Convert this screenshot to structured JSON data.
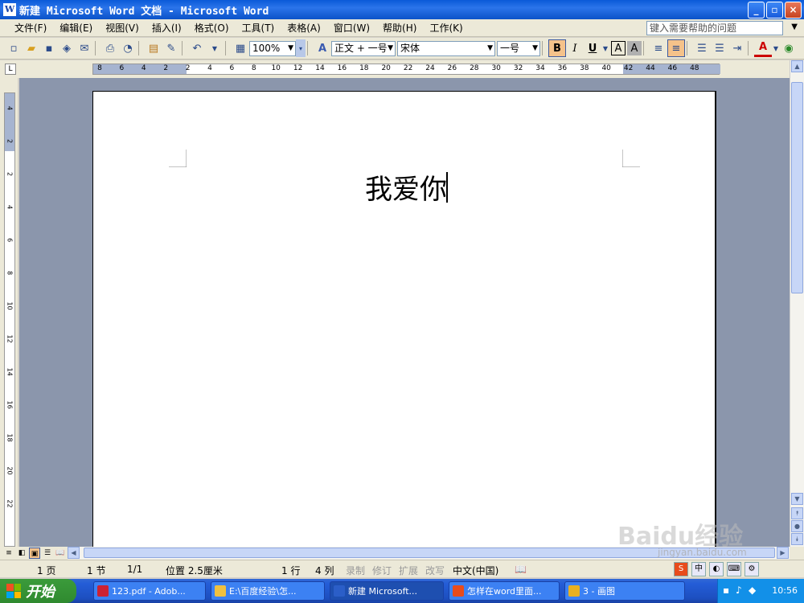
{
  "window": {
    "title": "新建 Microsoft Word 文档 - Microsoft Word",
    "icon": "word-icon",
    "controls": [
      "_",
      "▫",
      "×"
    ]
  },
  "menu": [
    "文件(F)",
    "编辑(E)",
    "视图(V)",
    "插入(I)",
    "格式(O)",
    "工具(T)",
    "表格(A)",
    "窗口(W)",
    "帮助(H)",
    "工作(K)"
  ],
  "help_search": {
    "placeholder": "键入需要帮助的问题"
  },
  "toolbar": {
    "zoom": "100%",
    "style": "正文 + 一号",
    "font": "宋体",
    "size": "一号",
    "bold": "B",
    "italic": "I",
    "underline": "U",
    "font_color": "A",
    "highlight": "A"
  },
  "ruler": {
    "h_labels": [
      "8",
      "6",
      "4",
      "2",
      "2",
      "4",
      "6",
      "8",
      "10",
      "12",
      "14",
      "16",
      "18",
      "20",
      "22",
      "24",
      "26",
      "28",
      "30",
      "32",
      "34",
      "36",
      "38",
      "40",
      "42",
      "44",
      "46",
      "48"
    ],
    "v_labels": [
      "4",
      "2",
      "2",
      "4",
      "6",
      "8",
      "10",
      "12",
      "14",
      "16",
      "18",
      "20",
      "22"
    ]
  },
  "document": {
    "text": "我爱你"
  },
  "status": {
    "page": "1 页",
    "section": "1 节",
    "page_of": "1/1",
    "position": "位置 2.5厘米",
    "line": "1 行",
    "column": "4 列",
    "rec": "录制",
    "trk": "修订",
    "ext": "扩展",
    "ovr": "改写",
    "language": "中文(中国)"
  },
  "taskbar": {
    "start": "开始",
    "tasks": [
      "123.pdf - Adob...",
      "E:\\百度经验\\怎...",
      "新建 Microsoft...",
      "怎样在word里面...",
      "3 - 画图"
    ],
    "clock": "10:56"
  },
  "watermark": {
    "brand": "Baidu经验",
    "url": "jingyan.baidu.com"
  },
  "colors": {
    "titlebar": "#0a5ad8",
    "workarea": "#8b96ac",
    "taskbar": "#245dd7",
    "start": "#2f8a2f"
  }
}
